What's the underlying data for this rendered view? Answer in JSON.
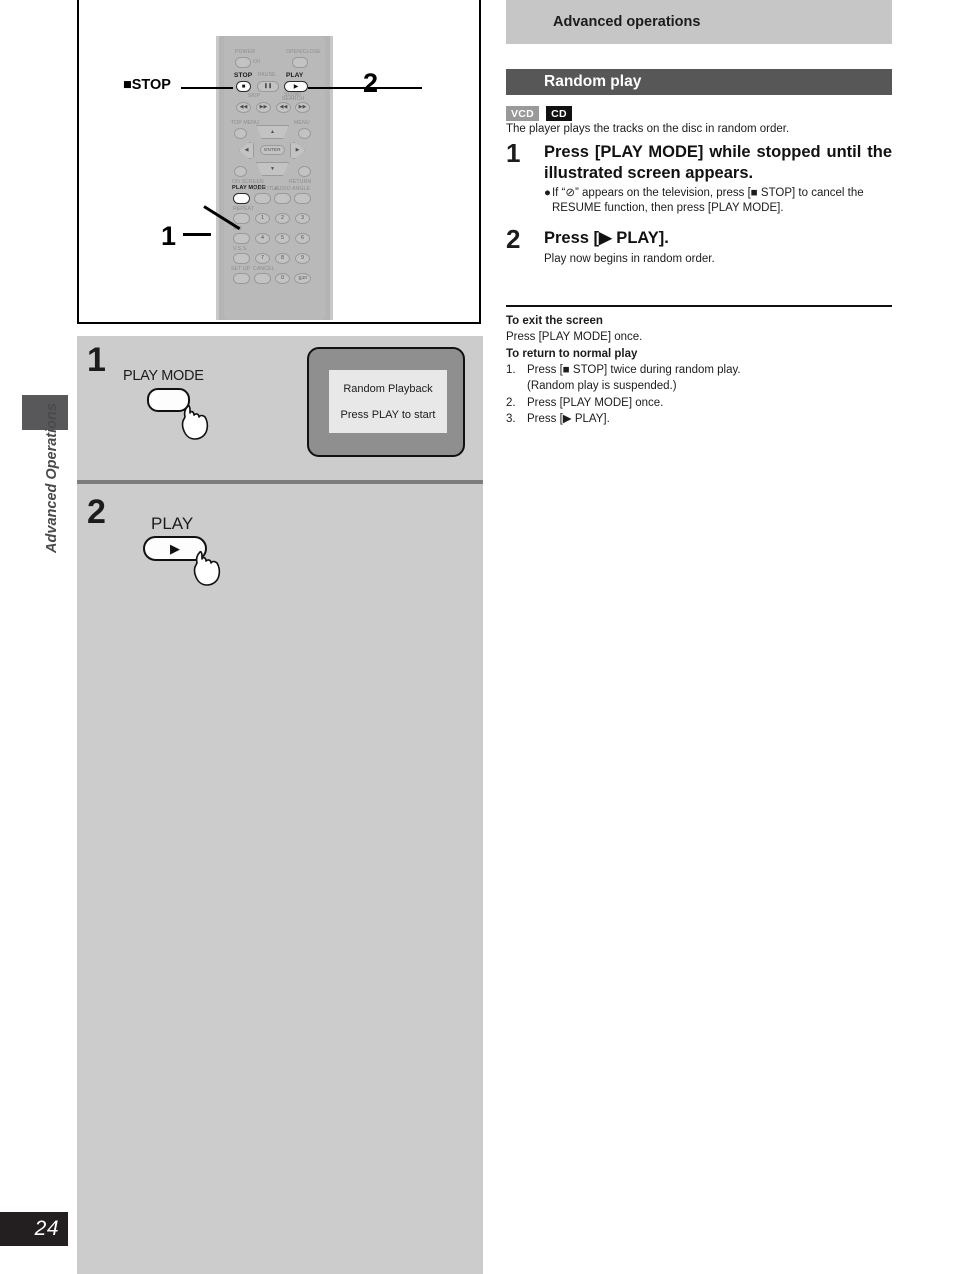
{
  "sidebar": {
    "section_label": "Advanced Operations",
    "page_number": "24"
  },
  "left_column": {
    "remote": {
      "callout_stop": "■STOP",
      "callout_two": "2",
      "callout_one": "1",
      "labels": {
        "power": "POWER",
        "power_glyph": "⏻/I",
        "open_close": "OPEN/CLOSE",
        "stop": "STOP",
        "pause": "PAUSE",
        "play": "PLAY",
        "skip": "SKIP",
        "slow": "SLOW/",
        "search": "SEARCH",
        "top_menu": "TOP MENU",
        "menu": "MENU",
        "enter": "ENTER",
        "on_screen": "ON SCREEN",
        "play_mode": "PLAY MODE",
        "subtitle": "SUBTITLE",
        "audio": "AUDIO",
        "return": "RETURN",
        "angle": "ANGLE",
        "repeat": "REPEAT",
        "ab": "A-B",
        "vss": "V.S.S.",
        "set_up": "SET UP",
        "cancel": "CANCEL"
      },
      "keypad": [
        "1",
        "2",
        "3",
        "4",
        "5",
        "6",
        "7",
        "8",
        "9",
        "0",
        "≧10"
      ]
    },
    "step1": {
      "number": "1",
      "button_label": "PLAY MODE",
      "tv_line1": "Random Playback",
      "tv_line2": "Press PLAY to start"
    },
    "step2": {
      "number": "2",
      "button_label": "PLAY",
      "button_glyph": "▶"
    }
  },
  "right_column": {
    "header_bar": "Advanced operations",
    "section_title": "Random play",
    "badges": [
      {
        "text": "VCD",
        "style": "gray"
      },
      {
        "text": "CD",
        "style": "black"
      }
    ],
    "intro": "The player plays the tracks on the disc in random order.",
    "steps": [
      {
        "number": "1",
        "title": "Press [PLAY MODE] while stopped until the illustrated screen appears.",
        "bullet": "If “⊘” appears on the television, press [■ STOP] to cancel the RESUME function, then press [PLAY MODE]."
      },
      {
        "number": "2",
        "title": "Press [▶ PLAY].",
        "sub": "Play now begins in random order."
      }
    ],
    "exit_section": {
      "exit_heading": "To exit the screen",
      "exit_text": "Press [PLAY MODE] once.",
      "return_heading": "To return to normal play",
      "items": [
        {
          "index": "1.",
          "text": "Press [■ STOP] twice during random play.",
          "cont": "(Random play is suspended.)"
        },
        {
          "index": "2.",
          "text": "Press [PLAY MODE] once."
        },
        {
          "index": "3.",
          "text": "Press [▶ PLAY]."
        }
      ]
    }
  },
  "colors": {
    "panel_gray": "#cccccc",
    "header_gray": "#c6c6c6",
    "section_dark": "#575757",
    "tab_dark": "#58585a",
    "page_box": "#231f20"
  }
}
